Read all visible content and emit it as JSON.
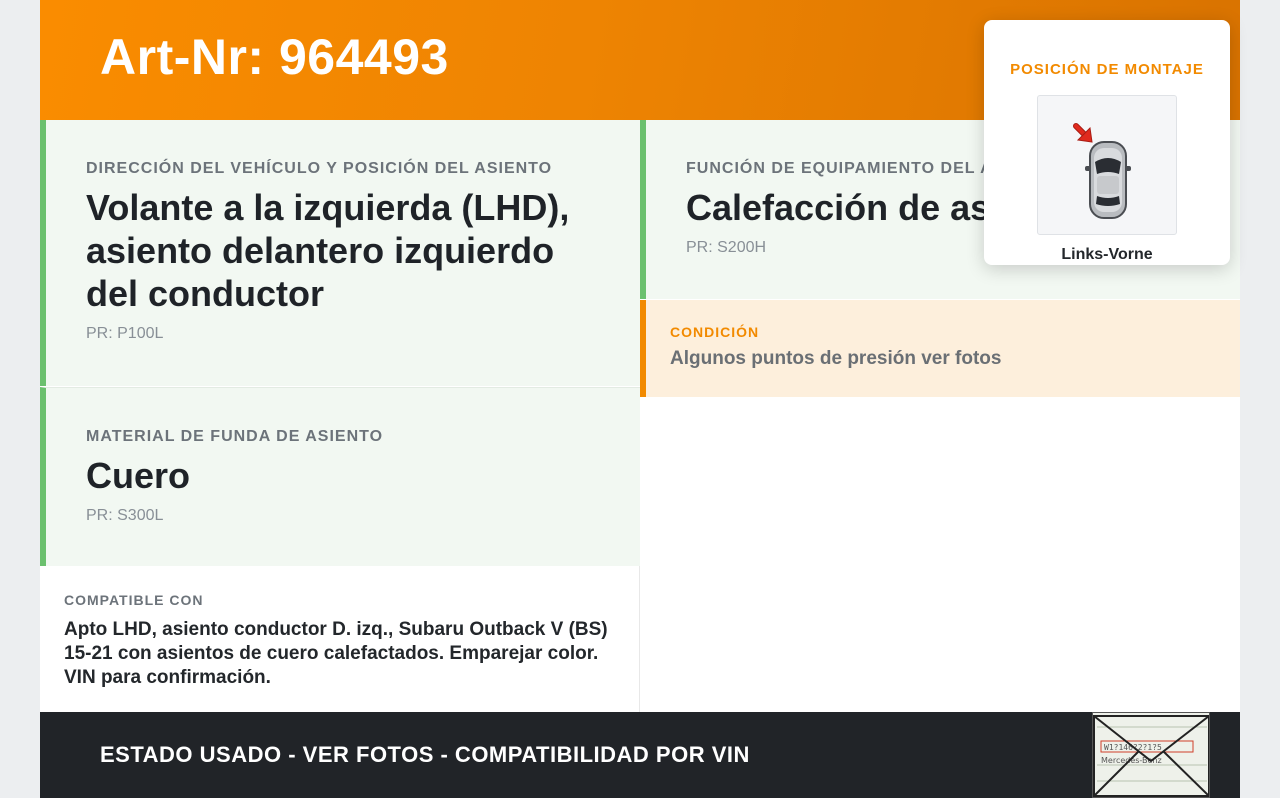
{
  "header": {
    "title": "Art-Nr: 964493"
  },
  "direction": {
    "label": "DIRECCIÓN DEL VEHÍCULO Y POSICIÓN DEL ASIENTO",
    "value": "Volante a la izquierda (LHD), asiento delantero izquierdo del conductor",
    "pr": "PR: P100L"
  },
  "function": {
    "label": "FUNCIÓN DE EQUIPAMIENTO DEL ASIENTO",
    "value": "Calefacción de asiento",
    "pr": "PR: S200H"
  },
  "material": {
    "label": "MATERIAL DE FUNDA DE ASIENTO",
    "value": "Cuero",
    "pr": "PR: S300L"
  },
  "condition": {
    "label": "CONDICIÓN",
    "value": "Algunos puntos de presión ver fotos"
  },
  "compatible": {
    "label": "COMPATIBLE CON",
    "value": "Apto LHD, asiento conductor D. izq., Subaru Outback V (BS) 15-21 con asientos de cuero calefactados. Emparejar color. VIN para confirmación."
  },
  "mount": {
    "title": "POSICIÓN DE MONTAJE",
    "caption": "Links-Vorne",
    "icon": "car-top-view-icon"
  },
  "footer": {
    "text": "ESTADO USADO - VER FOTOS - COMPATIBILIDAD POR VIN",
    "stamp_text": [
      "W1?146?2?1?5",
      "Mercedes-Benz"
    ]
  },
  "colors": {
    "accent": "#f28a00",
    "card_green": "#6bc06e",
    "footer_bg": "#212428"
  }
}
